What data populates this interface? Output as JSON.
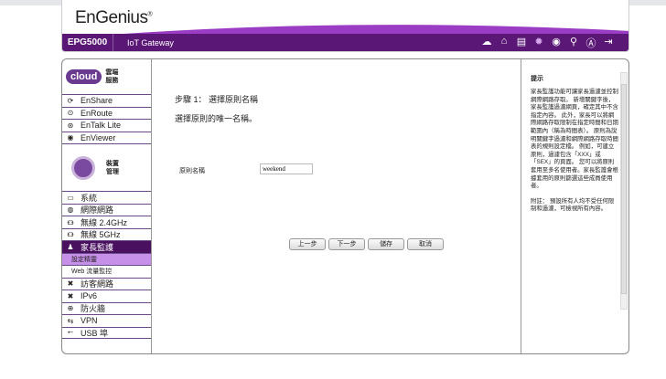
{
  "brand": "EnGenius",
  "header": {
    "model": "EPG5000",
    "product": "IoT Gateway",
    "icons": [
      "cloud-download-icon",
      "home-icon",
      "wizard-icon",
      "gear-icon",
      "plug-icon",
      "location-icon",
      "user-icon",
      "logout-icon"
    ]
  },
  "sidebar": {
    "cloud_badge": "cloud",
    "cloud_label": "雲端服務",
    "cloud_items": [
      {
        "label": "EnShare"
      },
      {
        "label": "EnRoute"
      },
      {
        "label": "EnTalk Lite"
      },
      {
        "label": "EnViewer"
      }
    ],
    "device_label": "裝置管理",
    "device_items": [
      {
        "label": "系統"
      },
      {
        "label": "網際網路"
      },
      {
        "label": "無線 2.4GHz"
      },
      {
        "label": "無線 5GHz"
      },
      {
        "label": "家長監護"
      },
      {
        "label": "設定精靈"
      },
      {
        "label": "Web 流量監控"
      },
      {
        "label": "訪客網路"
      },
      {
        "label": "IPv6"
      },
      {
        "label": "防火牆"
      },
      {
        "label": "VPN"
      },
      {
        "label": "USB 埠"
      }
    ]
  },
  "content": {
    "step": "步驟 1： 選擇原則名稱",
    "desc": "選擇原則的唯一名稱。",
    "field_label": "原則名稱",
    "field_value": "weekend",
    "buttons": {
      "prev": "上一步",
      "next": "下一步",
      "save": "儲存",
      "cancel": "取消"
    }
  },
  "help": {
    "title": "提示",
    "text": "家長監護功能可讓家長過濾並控制網際網路存取。 新增關鍵字後，家長監護過濾網頁，確定其中不含指定內容。 此外，家長可以將網際網路存取限制在指定時間和日期範圍內（稱為時間表）。 原則為說明關鍵字過濾和網際網路存取時間表的規則設定檔。 例如，可建立原則，過濾包含「XXX」或「SEX」的頁面。 您可以將原則套用至多名使用者。家長監護會根據套用的原則篩選這些成員使用者。",
    "note": "附註： 預設所有人均不受任何限制和過濾，可檢視所有內容。"
  }
}
